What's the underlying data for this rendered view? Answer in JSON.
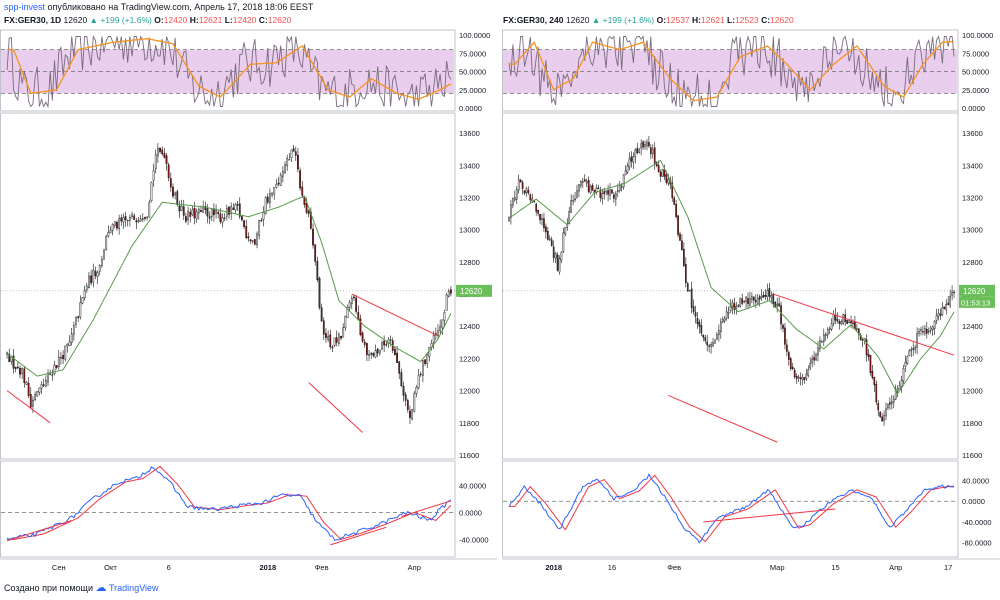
{
  "header": {
    "author": "spp-invest",
    "published_text": "опубликовано на TradingView.com, Апрель 17, 2018 18:06 EEST"
  },
  "footer": {
    "created_text": "Создано при помощи",
    "brand": "TradingView",
    "logo_icon": "tradingview-logo-icon"
  },
  "colors": {
    "bull": "#f5f5f5",
    "bear": "#8b1a1a",
    "wick": "#111111",
    "ma": "#5a9a4c",
    "trend": "#f23645",
    "stoch_k": "#7b6b7f",
    "stoch_d": "#f7931e",
    "stoch_band": "#e1bee7",
    "macd": "#2962ff",
    "signal": "#f23645",
    "price_tag": "#6bbf59"
  },
  "chart_data": [
    {
      "type": "candlestick",
      "title": "FX:GER30, 1D",
      "quote": {
        "last": "12620",
        "change": "+199 (+1.6%)",
        "O": "12420",
        "H": "12621",
        "L": "12420",
        "C": "12620"
      },
      "price_tag": "12620",
      "x_tick_labels": [
        "Сен",
        "Окт",
        "6",
        "2018",
        "Фев",
        "Апр"
      ],
      "x_tick_idx": [
        24,
        48,
        75,
        121,
        146,
        189
      ],
      "n_bars": 207,
      "price_axis": {
        "ticks": [
          13600,
          13400,
          13200,
          13000,
          12800,
          12600,
          12400,
          12200,
          12000,
          11800,
          11600
        ],
        "ylim": [
          11600,
          13700
        ]
      },
      "stoch_axis": {
        "ticks": [
          "100.0000",
          "75.0000",
          "50.0000",
          "25.0000",
          "0.0000"
        ],
        "values": [
          100,
          75,
          50,
          25,
          0
        ],
        "band": [
          20,
          80
        ]
      },
      "macd_axis": {
        "ticks": [
          "40.0000",
          "0.0000",
          "-40.0000"
        ],
        "values": [
          40,
          0,
          -40
        ],
        "ylim": [
          -60,
          70
        ]
      },
      "price_path": [
        [
          0,
          12220
        ],
        [
          8,
          12120
        ],
        [
          12,
          11930
        ],
        [
          18,
          12040
        ],
        [
          23,
          12150
        ],
        [
          30,
          12290
        ],
        [
          38,
          12660
        ],
        [
          44,
          12780
        ],
        [
          48,
          13000
        ],
        [
          54,
          13040
        ],
        [
          61,
          13080
        ],
        [
          66,
          13110
        ],
        [
          70,
          13470
        ],
        [
          74,
          13480
        ],
        [
          78,
          13220
        ],
        [
          84,
          13080
        ],
        [
          92,
          13110
        ],
        [
          100,
          13080
        ],
        [
          108,
          13130
        ],
        [
          112,
          12980
        ],
        [
          116,
          12920
        ],
        [
          121,
          13180
        ],
        [
          125,
          13240
        ],
        [
          129,
          13350
        ],
        [
          134,
          13510
        ],
        [
          138,
          13200
        ],
        [
          141,
          13070
        ],
        [
          144,
          12810
        ],
        [
          147,
          12400
        ],
        [
          151,
          12280
        ],
        [
          156,
          12330
        ],
        [
          161,
          12600
        ],
        [
          165,
          12370
        ],
        [
          169,
          12210
        ],
        [
          175,
          12270
        ],
        [
          179,
          12340
        ],
        [
          185,
          11990
        ],
        [
          188,
          11820
        ],
        [
          192,
          12080
        ],
        [
          197,
          12270
        ],
        [
          202,
          12380
        ],
        [
          206,
          12620
        ]
      ],
      "ma_path": [
        [
          0,
          12230
        ],
        [
          14,
          12090
        ],
        [
          26,
          12130
        ],
        [
          40,
          12440
        ],
        [
          58,
          12900
        ],
        [
          72,
          13170
        ],
        [
          92,
          13140
        ],
        [
          112,
          13080
        ],
        [
          126,
          13140
        ],
        [
          138,
          13210
        ],
        [
          146,
          12920
        ],
        [
          154,
          12560
        ],
        [
          166,
          12400
        ],
        [
          180,
          12270
        ],
        [
          192,
          12180
        ],
        [
          200,
          12320
        ],
        [
          206,
          12480
        ]
      ],
      "stoch_path": [
        [
          0,
          80
        ],
        [
          8,
          20
        ],
        [
          20,
          25
        ],
        [
          30,
          80
        ],
        [
          46,
          90
        ],
        [
          62,
          95
        ],
        [
          74,
          88
        ],
        [
          86,
          30
        ],
        [
          96,
          15
        ],
        [
          110,
          60
        ],
        [
          122,
          62
        ],
        [
          134,
          85
        ],
        [
          146,
          25
        ],
        [
          156,
          15
        ],
        [
          166,
          40
        ],
        [
          178,
          20
        ],
        [
          188,
          12
        ],
        [
          198,
          25
        ],
        [
          206,
          38
        ]
      ],
      "macd_path": [
        [
          0,
          -40
        ],
        [
          14,
          -32
        ],
        [
          30,
          -8
        ],
        [
          40,
          20
        ],
        [
          52,
          45
        ],
        [
          60,
          50
        ],
        [
          68,
          68
        ],
        [
          76,
          42
        ],
        [
          84,
          8
        ],
        [
          96,
          4
        ],
        [
          108,
          10
        ],
        [
          118,
          14
        ],
        [
          128,
          26
        ],
        [
          136,
          24
        ],
        [
          144,
          -15
        ],
        [
          152,
          -40
        ],
        [
          162,
          -30
        ],
        [
          174,
          -16
        ],
        [
          186,
          0
        ],
        [
          196,
          -12
        ],
        [
          206,
          20
        ]
      ],
      "trendlines": {
        "price": [
          [
            [
              0,
              12000
            ],
            [
              20,
              11800
            ]
          ],
          [
            [
              140,
              12050
            ],
            [
              165,
              11740
            ]
          ],
          [
            [
              160,
              12600
            ],
            [
              200,
              12340
            ]
          ]
        ],
        "macd": [
          [
            [
              0,
              -42
            ],
            [
              30,
              -12
            ]
          ],
          [
            [
              150,
              -48
            ],
            [
              176,
              -22
            ]
          ],
          [
            [
              183,
              -6
            ],
            [
              206,
              17
            ]
          ]
        ]
      }
    },
    {
      "type": "candlestick",
      "title": "FX:GER30, 240",
      "quote": {
        "last": "12620",
        "change": "+199 (+1.6%)",
        "O": "12537",
        "H": "12621",
        "L": "12523",
        "C": "12620"
      },
      "price_tag": "12620",
      "countdown": "01:53:13",
      "x_tick_labels": [
        "2018",
        "16",
        "Фев",
        "Мар",
        "15",
        "Апр",
        "17"
      ],
      "x_tick_idx": [
        23,
        53,
        85,
        138,
        168,
        199,
        226
      ],
      "n_bars": 230,
      "price_axis": {
        "ticks": [
          13600,
          13400,
          13200,
          13000,
          12800,
          12600,
          12400,
          12200,
          12000,
          11800,
          11600
        ],
        "ylim": [
          11600,
          13700
        ]
      },
      "stoch_axis": {
        "ticks": [
          "100.0000",
          "75.0000",
          "50.0000",
          "25.0000",
          "0.0000"
        ],
        "values": [
          100,
          75,
          50,
          25,
          0
        ],
        "band": [
          20,
          80
        ]
      },
      "macd_axis": {
        "ticks": [
          "40.0000",
          "0.0000",
          "-40.0000",
          "-80.0000"
        ],
        "values": [
          40,
          0,
          -40,
          -80
        ],
        "ylim": [
          -100,
          70
        ]
      },
      "price_path": [
        [
          0,
          13050
        ],
        [
          6,
          13300
        ],
        [
          12,
          13190
        ],
        [
          20,
          13010
        ],
        [
          26,
          12780
        ],
        [
          32,
          13120
        ],
        [
          38,
          13310
        ],
        [
          46,
          13230
        ],
        [
          56,
          13210
        ],
        [
          66,
          13500
        ],
        [
          72,
          13560
        ],
        [
          78,
          13380
        ],
        [
          84,
          13280
        ],
        [
          92,
          12700
        ],
        [
          98,
          12400
        ],
        [
          104,
          12270
        ],
        [
          112,
          12470
        ],
        [
          118,
          12540
        ],
        [
          126,
          12560
        ],
        [
          134,
          12590
        ],
        [
          140,
          12500
        ],
        [
          146,
          12140
        ],
        [
          152,
          12050
        ],
        [
          160,
          12260
        ],
        [
          168,
          12460
        ],
        [
          176,
          12430
        ],
        [
          184,
          12300
        ],
        [
          192,
          11830
        ],
        [
          198,
          11920
        ],
        [
          204,
          12130
        ],
        [
          212,
          12350
        ],
        [
          220,
          12430
        ],
        [
          226,
          12510
        ],
        [
          229,
          12620
        ]
      ],
      "ma_path": [
        [
          0,
          13070
        ],
        [
          14,
          13190
        ],
        [
          30,
          13030
        ],
        [
          44,
          13230
        ],
        [
          60,
          13290
        ],
        [
          78,
          13430
        ],
        [
          92,
          13080
        ],
        [
          104,
          12640
        ],
        [
          118,
          12490
        ],
        [
          134,
          12560
        ],
        [
          148,
          12380
        ],
        [
          162,
          12260
        ],
        [
          176,
          12410
        ],
        [
          190,
          12210
        ],
        [
          200,
          11980
        ],
        [
          212,
          12200
        ],
        [
          222,
          12340
        ],
        [
          229,
          12490
        ]
      ],
      "stoch_path": [
        [
          0,
          60
        ],
        [
          10,
          90
        ],
        [
          20,
          25
        ],
        [
          30,
          40
        ],
        [
          40,
          90
        ],
        [
          54,
          80
        ],
        [
          66,
          90
        ],
        [
          80,
          40
        ],
        [
          92,
          10
        ],
        [
          104,
          15
        ],
        [
          116,
          70
        ],
        [
          130,
          85
        ],
        [
          140,
          60
        ],
        [
          152,
          25
        ],
        [
          164,
          60
        ],
        [
          176,
          85
        ],
        [
          190,
          30
        ],
        [
          200,
          15
        ],
        [
          210,
          60
        ],
        [
          220,
          90
        ],
        [
          229,
          92
        ]
      ],
      "macd_path": [
        [
          0,
          -10
        ],
        [
          8,
          28
        ],
        [
          16,
          -5
        ],
        [
          26,
          -55
        ],
        [
          38,
          28
        ],
        [
          46,
          42
        ],
        [
          54,
          5
        ],
        [
          64,
          20
        ],
        [
          72,
          50
        ],
        [
          80,
          10
        ],
        [
          90,
          -50
        ],
        [
          98,
          -78
        ],
        [
          108,
          -30
        ],
        [
          120,
          -15
        ],
        [
          134,
          22
        ],
        [
          146,
          -52
        ],
        [
          152,
          -45
        ],
        [
          164,
          -5
        ],
        [
          176,
          22
        ],
        [
          186,
          8
        ],
        [
          196,
          -50
        ],
        [
          204,
          -20
        ],
        [
          214,
          22
        ],
        [
          222,
          28
        ],
        [
          229,
          30
        ]
      ],
      "trendlines": {
        "price": [
          [
            [
              82,
              11970
            ],
            [
              138,
              11680
            ]
          ],
          [
            [
              136,
              12600
            ],
            [
              229,
              12220
            ]
          ]
        ],
        "macd": [
          [
            [
              100,
              -40
            ],
            [
              168,
              -15
            ]
          ]
        ]
      }
    }
  ]
}
